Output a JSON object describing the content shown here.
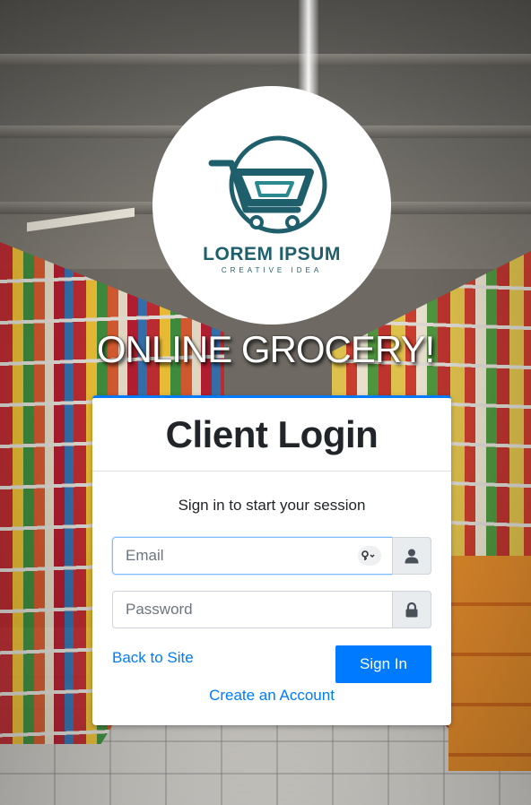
{
  "logo": {
    "name": "LOREM IPSUM",
    "tagline": "CREATIVE IDEA",
    "icon": "shopping-cart-logo",
    "color": "#1f5f6b"
  },
  "store_title": "ONLINE GROCERY!",
  "login": {
    "title": "Client Login",
    "message": "Sign in to start your session",
    "email_placeholder": "Email",
    "email_value": "",
    "password_placeholder": "Password",
    "password_value": "",
    "email_icon": "user-icon",
    "password_icon": "lock-icon",
    "back_link": "Back to Site",
    "signin_button": "Sign In",
    "create_account_link": "Create an Account"
  },
  "colors": {
    "accent": "#007bff",
    "card_bg": "#ffffff",
    "addon_bg": "#e9ecef"
  }
}
